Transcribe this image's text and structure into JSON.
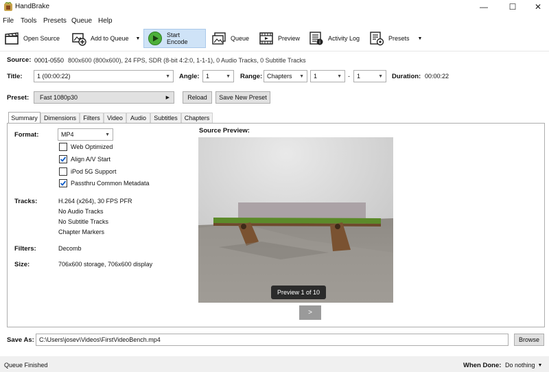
{
  "window": {
    "title": "HandBrake"
  },
  "menu": [
    "File",
    "Tools",
    "Presets",
    "Queue",
    "Help"
  ],
  "toolbar": {
    "open_source": "Open Source",
    "add_to_queue": "Add to Queue",
    "start_encode": "Start Encode",
    "queue": "Queue",
    "preview": "Preview",
    "activity_log": "Activity Log",
    "presets": "Presets"
  },
  "source": {
    "label": "Source:",
    "name": "0001-0550",
    "info": "800x600 (800x600), 24 FPS, SDR (8-bit 4:2:0, 1-1-1), 0 Audio Tracks, 0 Subtitle Tracks"
  },
  "title_row": {
    "title_label": "Title:",
    "title_value": "1 (00:00:22)",
    "angle_label": "Angle:",
    "angle_value": "1",
    "range_label": "Range:",
    "range_value": "Chapters",
    "range_start": "1",
    "range_sep": "-",
    "range_end": "1",
    "duration_label": "Duration:",
    "duration_value": "00:00:22"
  },
  "preset_row": {
    "label": "Preset:",
    "value": "Fast 1080p30",
    "reload": "Reload",
    "save_new": "Save New Preset"
  },
  "tabs": [
    "Summary",
    "Dimensions",
    "Filters",
    "Video",
    "Audio",
    "Subtitles",
    "Chapters"
  ],
  "summary": {
    "format_label": "Format:",
    "format_value": "MP4",
    "options": [
      {
        "label": "Web Optimized",
        "checked": false
      },
      {
        "label": "Align A/V Start",
        "checked": true
      },
      {
        "label": "iPod 5G Support",
        "checked": false
      },
      {
        "label": "Passthru Common Metadata",
        "checked": true
      }
    ],
    "tracks_label": "Tracks:",
    "tracks": [
      "H.264 (x264), 30 FPS PFR",
      "No Audio Tracks",
      "No Subtitle Tracks",
      "Chapter Markers"
    ],
    "filters_label": "Filters:",
    "filters_value": "Decomb",
    "size_label": "Size:",
    "size_value": "706x600 storage, 706x600 display"
  },
  "preview": {
    "label": "Source Preview:",
    "badge": "Preview 1 of 10",
    "next": ">"
  },
  "save": {
    "label": "Save As:",
    "path": "C:\\Users\\josev\\Videos\\FirstVideoBench.mp4",
    "browse": "Browse"
  },
  "status": {
    "text": "Queue Finished",
    "when_done_label": "When Done:",
    "when_done_value": "Do nothing"
  }
}
